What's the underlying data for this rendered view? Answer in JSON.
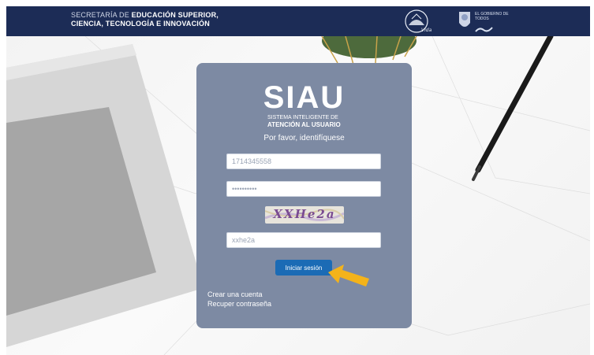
{
  "header": {
    "org_name_light": "SECRETARÍA DE",
    "org_name_bold": "EDUCACIÓN SUPERIOR,",
    "org_name_line2": "CIENCIA, TECNOLOGÍA E INNOVACIÓN",
    "gov_logo_text": "EL GOBIERNO DE TODOS",
    "bar_color": "#1c2c56"
  },
  "card": {
    "brand_title": "SIAU",
    "brand_subtitle_1": "SISTEMA INTELIGENTE DE",
    "brand_subtitle_2": "ATENCIÓN AL USUARIO",
    "prompt": "Por favor, identifíquese",
    "color": "#7d8aa3"
  },
  "form": {
    "username_value": "1714345558",
    "password_value": "••••••••••",
    "captcha_image_text": "XXHe2a",
    "captcha_value": "xxhe2a",
    "login_button": "Iniciar sesión",
    "button_color": "#1b6bb5"
  },
  "links": {
    "create_account": "Crear una cuenta",
    "recover_password": "Recuper contraseña"
  },
  "annotation": {
    "arrow_color": "#f4b31a",
    "arrow_icon": "arrow-pointer-icon"
  }
}
